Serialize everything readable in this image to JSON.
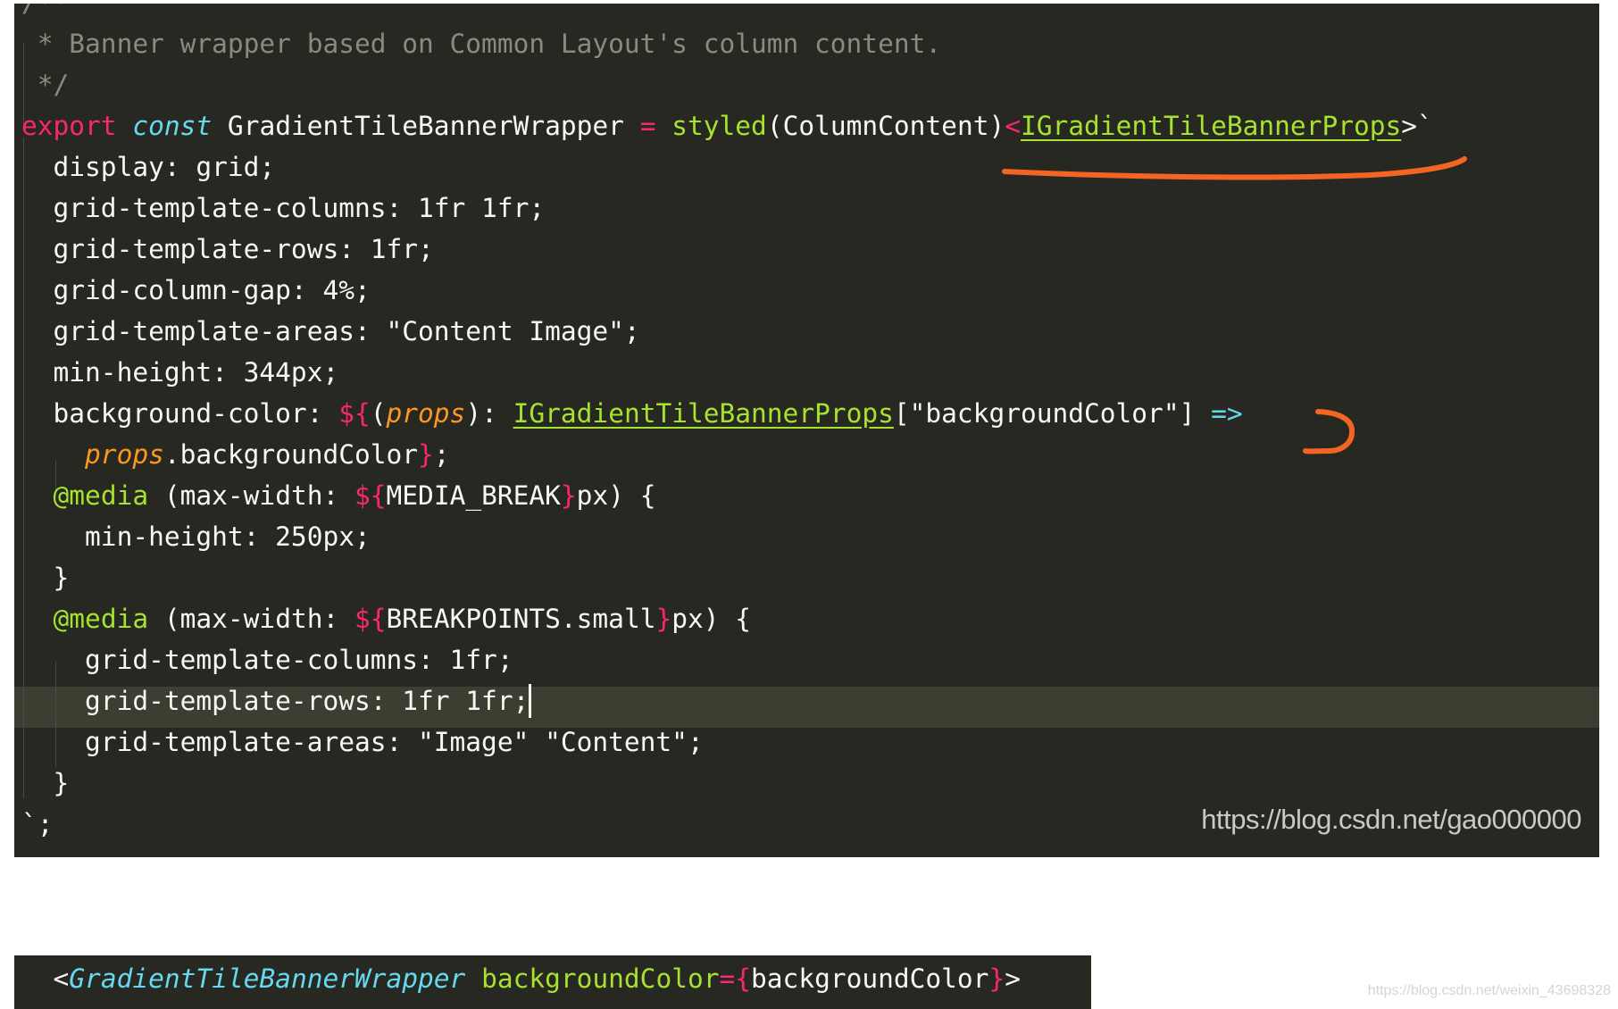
{
  "code": {
    "lines": [
      {
        "t": [
          [
            "/**",
            "c-comment"
          ]
        ]
      },
      {
        "t": [
          [
            " * Banner wrapper based on Common Layout's column content.",
            "c-comment"
          ]
        ]
      },
      {
        "t": [
          [
            " */",
            "c-comment"
          ]
        ]
      },
      {
        "t": [
          [
            "export",
            "c-kw"
          ],
          [
            " ",
            ""
          ],
          [
            "const",
            "c-storage"
          ],
          [
            " GradientTileBannerWrapper ",
            ""
          ],
          [
            "=",
            "c-op"
          ],
          [
            " ",
            ""
          ],
          [
            "styled",
            "c-fn"
          ],
          [
            "(ColumnContent)",
            ""
          ],
          [
            "<",
            "c-op"
          ],
          [
            "IGradientTileBannerProps",
            "c-ul"
          ],
          [
            ">`",
            ""
          ]
        ]
      },
      {
        "t": [
          [
            "  display: grid;",
            ""
          ]
        ]
      },
      {
        "t": [
          [
            "  grid-template-columns: 1fr 1fr;",
            ""
          ]
        ]
      },
      {
        "t": [
          [
            "  grid-template-rows: 1fr;",
            ""
          ]
        ]
      },
      {
        "t": [
          [
            "  grid-column-gap: 4%;",
            ""
          ]
        ]
      },
      {
        "t": [
          [
            "  grid-template-areas: \"Content Image\";",
            ""
          ]
        ]
      },
      {
        "t": [
          [
            "  min-height: 344px;",
            ""
          ]
        ]
      },
      {
        "t": [
          [
            "  background-color: ",
            ""
          ],
          [
            "${",
            "c-interp"
          ],
          [
            "(",
            ""
          ],
          [
            "props",
            "c-param"
          ],
          [
            "): ",
            ""
          ],
          [
            "IGradientTileBannerProps",
            "c-ul"
          ],
          [
            "[\"backgroundColor\"] ",
            ""
          ],
          [
            "=>",
            "c-arrow"
          ]
        ]
      },
      {
        "t": [
          [
            "    ",
            ""
          ],
          [
            "props",
            "c-param"
          ],
          [
            ".backgroundColor",
            ""
          ],
          [
            "}",
            "c-interp"
          ],
          [
            ";",
            ""
          ]
        ]
      },
      {
        "t": [
          [
            "  ",
            ""
          ],
          [
            "@media",
            "c-at"
          ],
          [
            " (max-width: ",
            ""
          ],
          [
            "${",
            "c-interp"
          ],
          [
            "MEDIA_BREAK",
            ""
          ],
          [
            "}",
            "c-interp"
          ],
          [
            "px) {",
            ""
          ]
        ]
      },
      {
        "t": [
          [
            "    min-height: 250px;",
            ""
          ]
        ]
      },
      {
        "t": [
          [
            "  }",
            ""
          ]
        ]
      },
      {
        "t": [
          [
            "  ",
            ""
          ],
          [
            "@media",
            "c-at"
          ],
          [
            " (max-width: ",
            ""
          ],
          [
            "${",
            "c-interp"
          ],
          [
            "BREAKPOINTS.small",
            ""
          ],
          [
            "}",
            "c-interp"
          ],
          [
            "px) {",
            ""
          ]
        ]
      },
      {
        "t": [
          [
            "    grid-template-columns: 1fr;",
            ""
          ]
        ]
      },
      {
        "t": [
          [
            "    grid-template-rows: 1fr 1fr;",
            ""
          ]
        ],
        "active": true
      },
      {
        "t": [
          [
            "    grid-template-areas: \"Image\" \"Content\";",
            ""
          ]
        ]
      },
      {
        "t": [
          [
            "  }",
            ""
          ]
        ]
      },
      {
        "t": [
          [
            "`;",
            ""
          ]
        ]
      }
    ]
  },
  "watermark_url": "https://blog.csdn.net/gao000000",
  "snippet2": {
    "line": [
      [
        "  ",
        ""
      ],
      [
        "<",
        ""
      ],
      [
        "GradientTileBannerWrapper",
        "c-tag"
      ],
      [
        " ",
        ""
      ],
      [
        "backgroundColor",
        "c-attr"
      ],
      [
        "=",
        "c-op"
      ],
      [
        "{",
        "c-interp"
      ],
      [
        "backgroundColor",
        ""
      ],
      [
        "}",
        "c-interp"
      ],
      [
        ">",
        ""
      ]
    ]
  },
  "page_watermark": "https://blog.csdn.net/weixin_43698328",
  "colors": {
    "editor_bg": "#272822",
    "annotation": "#f26522",
    "keyword": "#f92672",
    "function": "#a6e22e",
    "storage": "#66d9ef",
    "param": "#fd971f",
    "comment": "#8a8a7f"
  }
}
